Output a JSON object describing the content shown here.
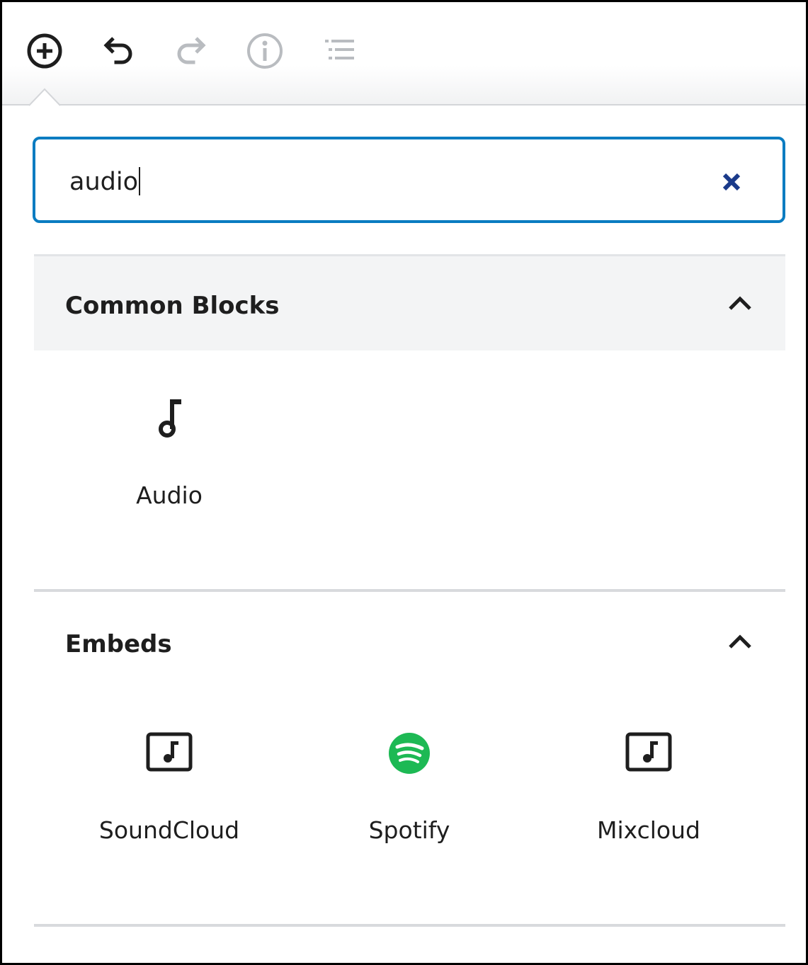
{
  "toolbar": {
    "buttons": [
      {
        "name": "add-block",
        "icon": "plus-circle-icon",
        "enabled": true
      },
      {
        "name": "undo",
        "icon": "undo-icon",
        "enabled": true
      },
      {
        "name": "redo",
        "icon": "redo-icon",
        "enabled": false
      },
      {
        "name": "info",
        "icon": "info-icon",
        "enabled": false
      },
      {
        "name": "outline",
        "icon": "list-outline-icon",
        "enabled": false
      }
    ]
  },
  "search": {
    "value": "audio",
    "clear_icon": "close-icon"
  },
  "panels": {
    "common": {
      "title": "Common Blocks",
      "toggle_icon": "chevron-up-icon",
      "items": [
        {
          "label": "Audio",
          "icon": "music-note-icon"
        }
      ]
    },
    "embeds": {
      "title": "Embeds",
      "toggle_icon": "chevron-up-icon",
      "items": [
        {
          "label": "SoundCloud",
          "icon": "embed-audio-icon"
        },
        {
          "label": "Spotify",
          "icon": "spotify-icon"
        },
        {
          "label": "Mixcloud",
          "icon": "embed-audio-icon"
        }
      ]
    }
  },
  "colors": {
    "focus_border": "#0a7cc1",
    "clear_icon": "#1a3a8a",
    "spotify_green": "#1db954",
    "disabled_icon": "#b9bcc0",
    "header_bg": "#f3f4f5"
  }
}
